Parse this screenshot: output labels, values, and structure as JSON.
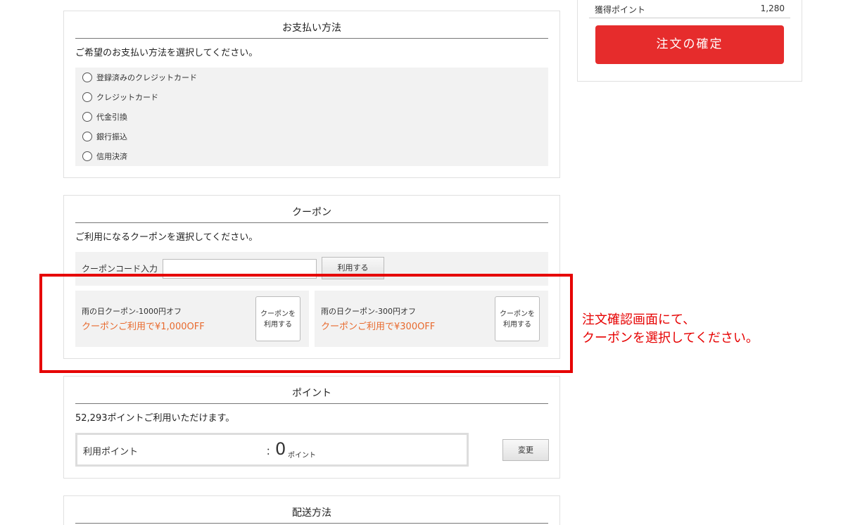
{
  "payment": {
    "title": "お支払い方法",
    "description": "ご希望のお支払い方法を選択してください。",
    "options": [
      "登録済みのクレジットカード",
      "クレジットカード",
      "代金引換",
      "銀行振込",
      "信用決済"
    ]
  },
  "coupon": {
    "title": "クーポン",
    "description": "ご利用になるクーポンを選択してください。",
    "code_label": "クーポンコード入力",
    "code_value": "",
    "apply_label": "利用する",
    "cards": [
      {
        "name": "雨の日クーポン-1000円オフ",
        "discount": "クーポンご利用で¥1,000OFF",
        "button_line1": "クーポンを",
        "button_line2": "利用する"
      },
      {
        "name": "雨の日クーポン-300円オフ",
        "discount": "クーポンご利用で¥300OFF",
        "button_line1": "クーポンを",
        "button_line2": "利用する"
      }
    ]
  },
  "points": {
    "title": "ポイント",
    "description": "52,293ポイントご利用いただけます。",
    "label": "利用ポイント",
    "colon": "：",
    "value": "0",
    "unit": "ポイント",
    "change_label": "変更"
  },
  "shipping": {
    "title": "配送方法"
  },
  "summary": {
    "earned_points_label": "獲得ポイント",
    "earned_points_value": "1,280",
    "confirm_label": "注文の確定"
  },
  "annotation": {
    "line1": "注文確認画面にて、",
    "line2": "クーポンを選択してください。"
  },
  "colors": {
    "confirm_button": "#e62c2c",
    "coupon_discount_text": "#e86a2e",
    "annotation": "#e60000"
  }
}
